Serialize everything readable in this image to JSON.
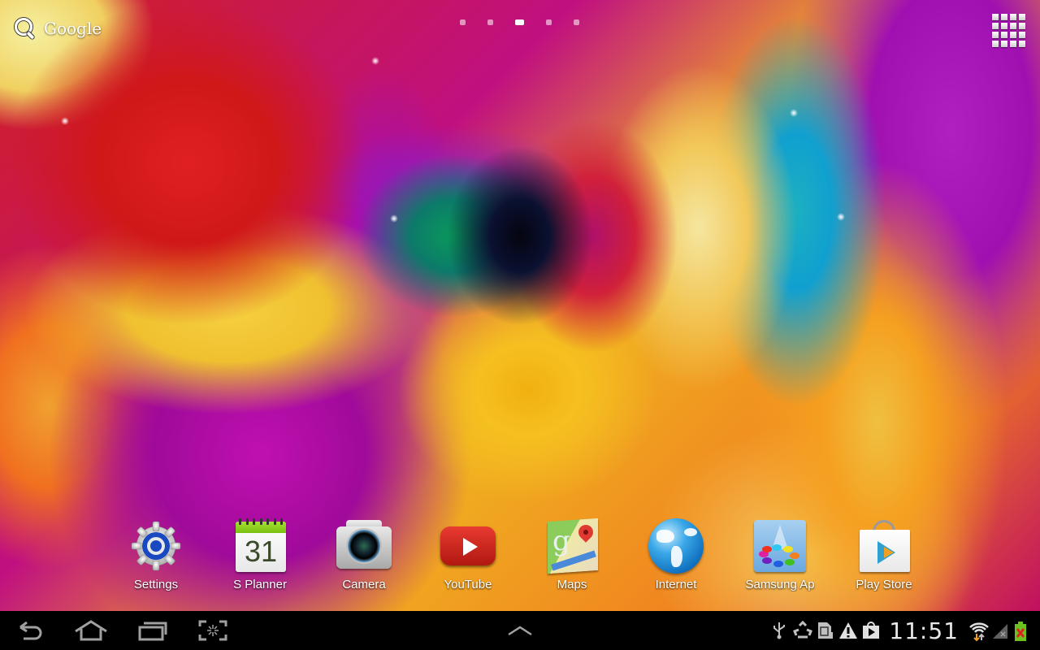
{
  "home": {
    "search": {
      "label": "Google",
      "icon": "search-icon"
    },
    "page_indicator": {
      "pages": 5,
      "current_page": 3
    },
    "apps_button": {
      "icon": "apps-grid-icon"
    }
  },
  "dock": {
    "apps": [
      {
        "label": "Settings",
        "icon": "settings-gear-icon"
      },
      {
        "label": "S Planner",
        "icon": "calendar-icon",
        "day": "31"
      },
      {
        "label": "Camera",
        "icon": "camera-icon"
      },
      {
        "label": "YouTube",
        "icon": "youtube-icon"
      },
      {
        "label": "Maps",
        "icon": "maps-icon"
      },
      {
        "label": "Internet",
        "icon": "globe-icon"
      },
      {
        "label": "Samsung Ap",
        "icon": "samsung-apps-icon"
      },
      {
        "label": "Play Store",
        "icon": "play-store-icon"
      }
    ]
  },
  "navbar": {
    "buttons": [
      {
        "name": "back",
        "icon": "back-icon"
      },
      {
        "name": "home",
        "icon": "home-icon"
      },
      {
        "name": "recent-apps",
        "icon": "recent-apps-icon"
      },
      {
        "name": "screenshot",
        "icon": "screenshot-icon"
      },
      {
        "name": "expand",
        "icon": "chevron-up-icon"
      }
    ],
    "status": {
      "icons": [
        "usb-icon",
        "recycle-icon",
        "sd-card-icon",
        "warning-icon",
        "play-store-notification-icon"
      ],
      "time": "11:51",
      "right_icons": [
        "wifi-icon",
        "signal-icon",
        "battery-icon"
      ]
    }
  },
  "colors": {
    "navbar_bg": "#000000",
    "clock": "#e8e8e8",
    "icon_gray": "#a0a0a0",
    "battery_green": "#6cc020",
    "battery_x": "#e02020",
    "wifi_arrow": "#f0a020"
  }
}
